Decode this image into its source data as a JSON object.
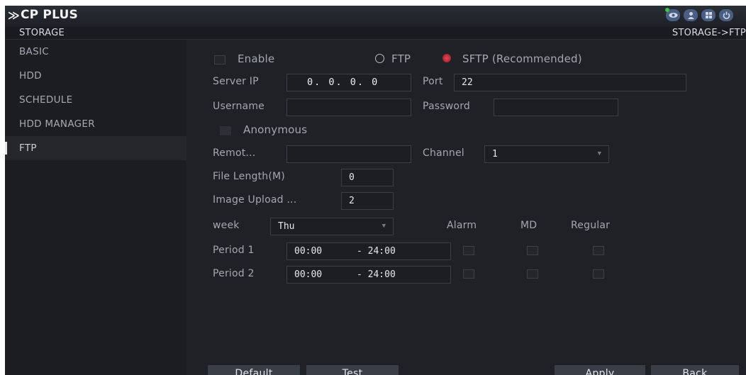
{
  "header": {
    "brand": "CP PLUS",
    "icons": [
      "eye-icon",
      "user-icon",
      "grid-icon",
      "power-icon"
    ],
    "status_dot_color": "#3dc24a"
  },
  "pathbar": {
    "title": "STORAGE",
    "breadcrumb": "STORAGE->FTP"
  },
  "sidebar": {
    "items": [
      {
        "label": "BASIC"
      },
      {
        "label": "HDD"
      },
      {
        "label": "SCHEDULE"
      },
      {
        "label": "HDD MANAGER"
      },
      {
        "label": "FTP",
        "active": true
      }
    ]
  },
  "form": {
    "enable_label": "Enable",
    "enable_checked": false,
    "ftp_label": "FTP",
    "sftp_label": "SFTP (Recommended)",
    "protocol_selected": "SFTP",
    "server_ip_label": "Server IP",
    "server_ip_value": "0. 0. 0. 0",
    "port_label": "Port",
    "port_value": "22",
    "username_label": "Username",
    "username_value": "",
    "password_label": "Password",
    "password_value": "",
    "anonymous_label": "Anonymous",
    "anonymous_checked": false,
    "remote_label": "Remot...",
    "remote_value": "",
    "channel_label": "Channel",
    "channel_value": "1",
    "file_length_label": "File Length(M)",
    "file_length_value": "0",
    "image_upload_label": "Image Upload ...",
    "image_upload_value": "2",
    "week_label": "week",
    "week_value": "Thu",
    "col_alarm": "Alarm",
    "col_md": "MD",
    "col_regular": "Regular",
    "periods": [
      {
        "label": "Period 1",
        "start": "00:00",
        "end": "- 24:00",
        "alarm": false,
        "md": false,
        "regular": false
      },
      {
        "label": "Period 2",
        "start": "00:00",
        "end": "- 24:00",
        "alarm": false,
        "md": false,
        "regular": false
      }
    ]
  },
  "buttons": {
    "default": "Default",
    "test": "Test",
    "apply": "Apply",
    "back": "Back"
  },
  "colors": {
    "accent_radio": "#d63a47",
    "panel_bg": "#1f2126",
    "sidebar_bg": "#1b1d21",
    "button_bg": "#3a3e46",
    "icon_bg": "#4a5e83"
  }
}
